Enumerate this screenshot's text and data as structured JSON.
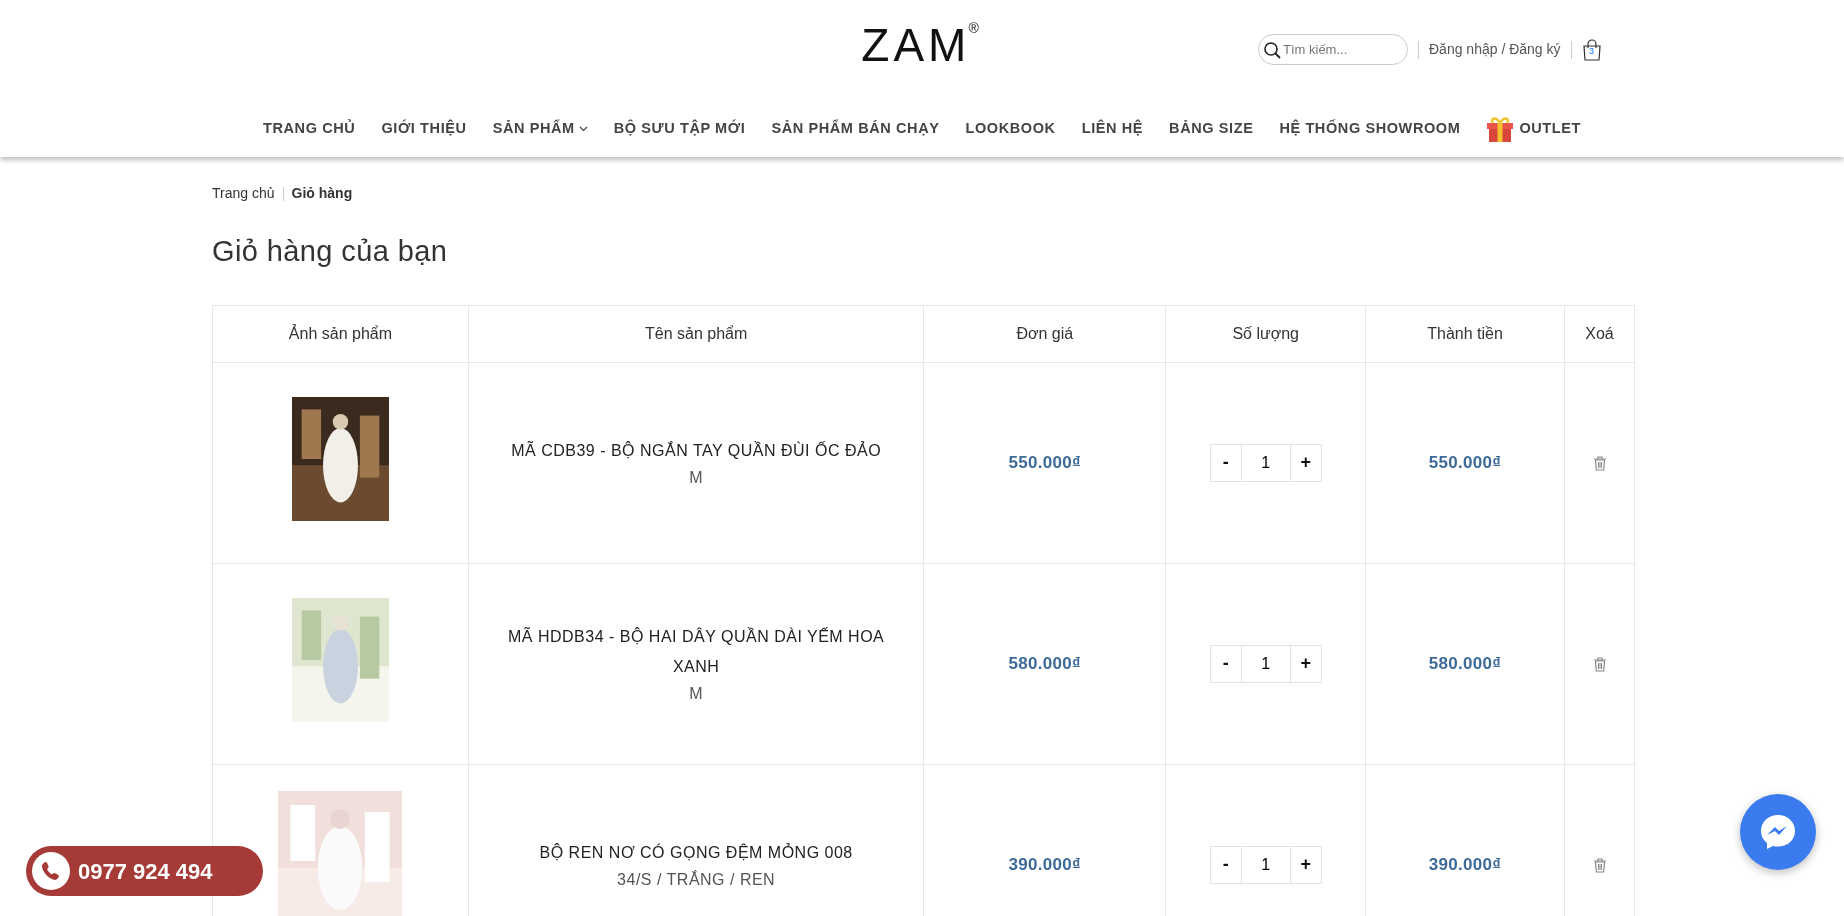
{
  "header": {
    "logo": "ZAM",
    "logo_mark": "®",
    "search": {
      "placeholder": "Tìm kiếm..."
    },
    "account_link": "Đăng nhập / Đăng ký",
    "cart_count": "3"
  },
  "nav": [
    {
      "label": "TRANG CHỦ",
      "dropdown": false,
      "kind": "plain"
    },
    {
      "label": "GIỚI THIỆU",
      "dropdown": false,
      "kind": "plain"
    },
    {
      "label": "SẢN PHẨM",
      "dropdown": true,
      "kind": "plain"
    },
    {
      "label": "BỘ SƯU TẬP MỚI",
      "dropdown": false,
      "kind": "plain"
    },
    {
      "label": "SẢN PHẨM BÁN CHẠY",
      "dropdown": false,
      "kind": "plain"
    },
    {
      "label": "LOOKBOOK",
      "dropdown": false,
      "kind": "plain"
    },
    {
      "label": "LIÊN HỆ",
      "dropdown": false,
      "kind": "plain"
    },
    {
      "label": "BẢNG SIZE",
      "dropdown": false,
      "kind": "plain"
    },
    {
      "label": "HỆ THỐNG SHOWROOM",
      "dropdown": false,
      "kind": "plain"
    },
    {
      "label": "OUTLET",
      "dropdown": false,
      "kind": "gift"
    }
  ],
  "breadcrumb": [
    {
      "label": "Trang chủ",
      "current": false
    },
    {
      "label": "Giỏ hàng",
      "current": true
    }
  ],
  "page_title": "Giỏ hàng của bạn",
  "table": {
    "columns": [
      "Ảnh sản phẩm",
      "Tên sản phẩm",
      "Đơn giá",
      "Số lượng",
      "Thành tiền",
      "Xoá"
    ],
    "rows": [
      {
        "name": "MÃ CDB39 - BỘ NGẮN TAY QUẦN ĐÙI ỐC ĐẢO",
        "variant": "M",
        "price": "550.000₫",
        "decrease": "-",
        "quantity": "1",
        "increase": "+",
        "total": "550.000₫"
      },
      {
        "name": "MÃ HDDB34 - BỘ HAI DÂY QUẦN DÀI YẾM HOA XANH",
        "variant": "M",
        "price": "580.000₫",
        "decrease": "-",
        "quantity": "1",
        "increase": "+",
        "total": "580.000₫"
      },
      {
        "name": "BỘ REN NƠ CÓ GỌNG ĐỆM MỎNG 008",
        "variant": "34/S / TRẮNG / REN",
        "price": "390.000₫",
        "decrease": "-",
        "quantity": "1",
        "increase": "+",
        "total": "390.000₫"
      }
    ]
  },
  "phone_button": "0977 924 494"
}
